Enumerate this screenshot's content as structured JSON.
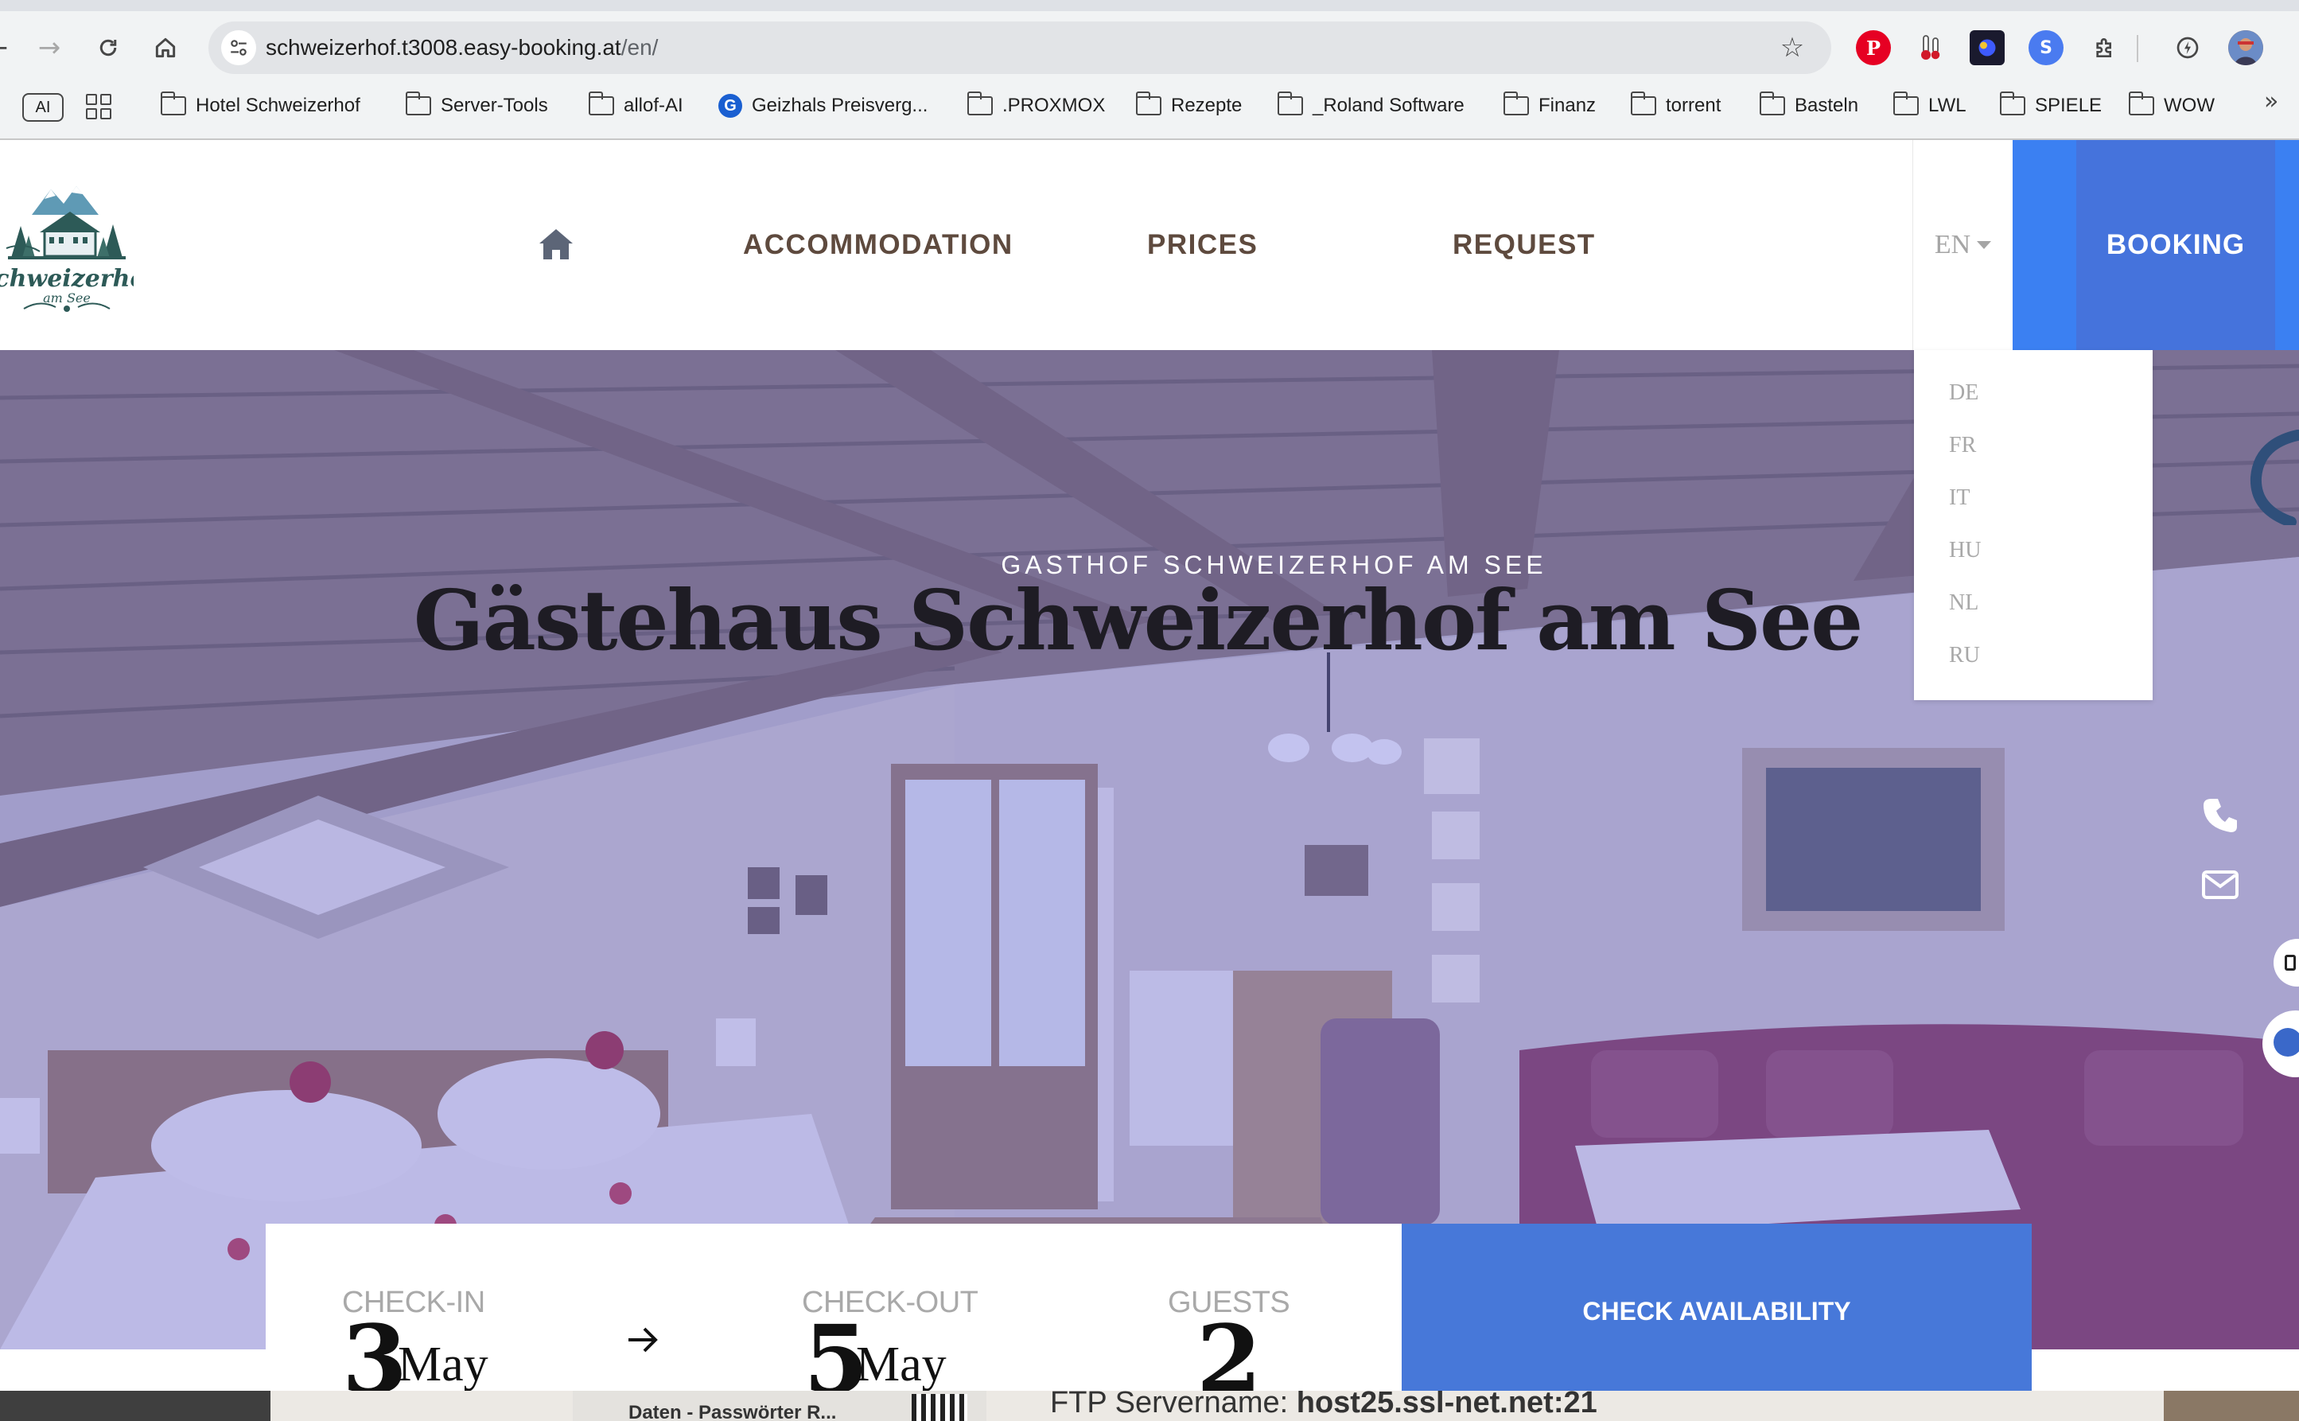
{
  "browser": {
    "url_host": "schweizerhof.t3008.easy-booking.at",
    "url_path": "/en/",
    "bookmarks": [
      {
        "label": "Hotel Schweizerhof",
        "type": "folder"
      },
      {
        "label": "Server-Tools",
        "type": "folder"
      },
      {
        "label": "allof-AI",
        "type": "folder"
      },
      {
        "label": "Geizhals Preisverg...",
        "type": "link"
      },
      {
        "label": ".PROXMOX",
        "type": "folder"
      },
      {
        "label": "Rezepte",
        "type": "folder"
      },
      {
        "label": "_Roland Software",
        "type": "folder"
      },
      {
        "label": "Finanz",
        "type": "folder"
      },
      {
        "label": "torrent",
        "type": "folder"
      },
      {
        "label": "Basteln",
        "type": "folder"
      },
      {
        "label": "LWL",
        "type": "folder"
      },
      {
        "label": "SPIELE",
        "type": "folder"
      },
      {
        "label": "WOW",
        "type": "folder"
      }
    ],
    "ai_badge": "AI",
    "extensions": [
      "pinterest-icon",
      "thermometer-extension-icon",
      "dark-extension-icon",
      "blue-s-extension-icon",
      "puzzle-extensions-icon",
      "performance-icon",
      "profile-avatar"
    ]
  },
  "site": {
    "logo_text": "Schweizerhof",
    "logo_subtext": "am See",
    "nav": {
      "accommodation": "ACCOMMODATION",
      "prices": "PRICES",
      "request": "REQUEST"
    },
    "language": {
      "current": "EN",
      "options": [
        "DE",
        "FR",
        "IT",
        "HU",
        "NL",
        "RU"
      ]
    },
    "booking_label": "BOOKING"
  },
  "hero": {
    "subtitle": "GASTHOF SCHWEIZERHOF AM SEE",
    "title": "Gästehaus Schweizerhof am See"
  },
  "booking_bar": {
    "checkin_label": "CHECK-IN",
    "checkin_day": "3",
    "checkin_month": "May",
    "checkout_label": "CHECK-OUT",
    "checkout_day": "5",
    "checkout_month": "May",
    "guests_label": "GUESTS",
    "guests_count": "2",
    "check_button": "CHECK AVAILABILITY"
  },
  "background_window": {
    "ftp_label": "FTP Servername:",
    "ftp_value": "host25.ssl-net.net:21",
    "doc_title": "Daten - Passwörter R..."
  },
  "colors": {
    "nav_text": "#5e4a3e",
    "booking_blue": "#3b80f2",
    "booking_inner": "#4573dc",
    "check_button": "#4778d9",
    "hero_overlay": "#6262d6"
  }
}
